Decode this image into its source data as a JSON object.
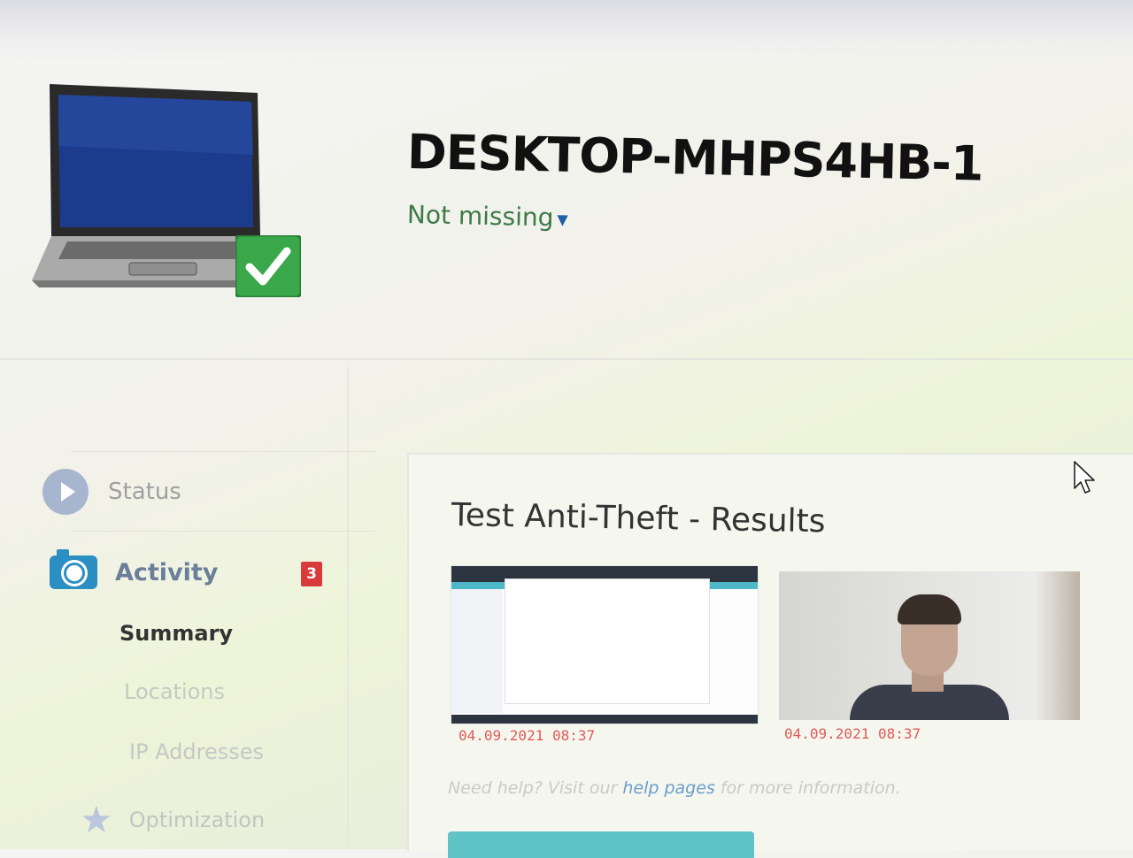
{
  "device": {
    "name": "DESKTOP-MHPS4HB-1",
    "status": "Not missing",
    "status_caret": "▼"
  },
  "sidebar": {
    "status_label": "Status",
    "activity_label": "Activity",
    "activity_badge": "3",
    "sub_items": [
      "Summary",
      "Locations",
      "IP Addresses"
    ],
    "optimization_label": "Optimization"
  },
  "panel": {
    "title": "Test Anti-Theft - Results",
    "screenshot_timestamp": "04.09.2021 08:37",
    "camera_timestamp": "04.09.2021 08:37",
    "help_prefix": "Need help? Visit our ",
    "help_link": "help pages",
    "help_suffix": " for more information."
  },
  "colors": {
    "status_ok": "#3c7a46",
    "badge": "#d93b3b",
    "camera_icon": "#2b8fc4",
    "check_badge": "#3aa84a"
  },
  "icons": {
    "device": "laptop-icon",
    "ok": "check-icon",
    "status": "play-icon",
    "activity": "camera-icon",
    "optimization": "star-icon",
    "cursor": "mouse-pointer-icon"
  }
}
